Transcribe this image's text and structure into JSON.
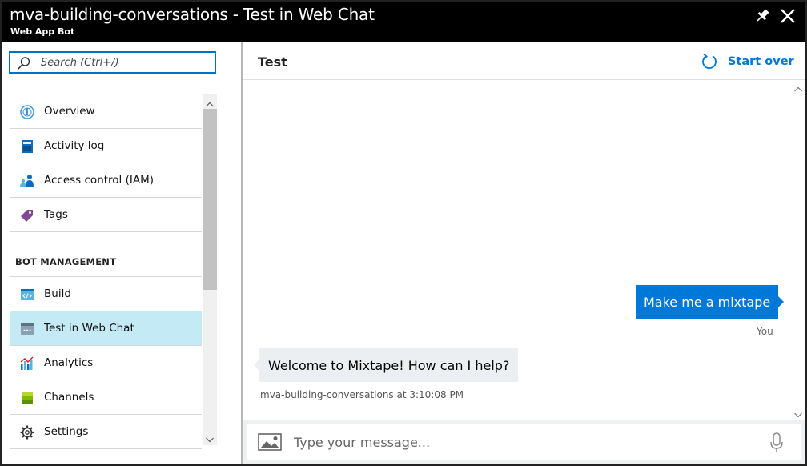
{
  "window": {
    "title": "mva-building-conversations - Test in Web Chat",
    "subtitle": "Web App Bot"
  },
  "search": {
    "placeholder": "Search (Ctrl+/)"
  },
  "sidebar": {
    "items_top": [
      {
        "label": "Overview",
        "icon": "overview-icon"
      },
      {
        "label": "Activity log",
        "icon": "activity-log-icon"
      },
      {
        "label": "Access control (IAM)",
        "icon": "access-control-icon"
      },
      {
        "label": "Tags",
        "icon": "tag-icon"
      }
    ],
    "section_heading": "BOT MANAGEMENT",
    "items_bot": [
      {
        "label": "Build",
        "icon": "build-icon"
      },
      {
        "label": "Test in Web Chat",
        "icon": "web-chat-icon",
        "active": true
      },
      {
        "label": "Analytics",
        "icon": "analytics-icon"
      },
      {
        "label": "Channels",
        "icon": "channels-icon"
      },
      {
        "label": "Settings",
        "icon": "gear-icon"
      }
    ]
  },
  "chat": {
    "header_title": "Test",
    "start_over_label": "Start over",
    "messages": [
      {
        "from": "user",
        "text": "Make me a mixtape",
        "meta": "You"
      },
      {
        "from": "bot",
        "text": "Welcome to Mixtape! How can I help?",
        "meta": "mva-building-conversations at 3:10:08 PM"
      }
    ],
    "input_placeholder": "Type your message..."
  },
  "colors": {
    "accent": "#0078d7",
    "active_nav": "#c4ebf5",
    "titlebar": "#000000",
    "bot_bubble": "#eceff1"
  }
}
